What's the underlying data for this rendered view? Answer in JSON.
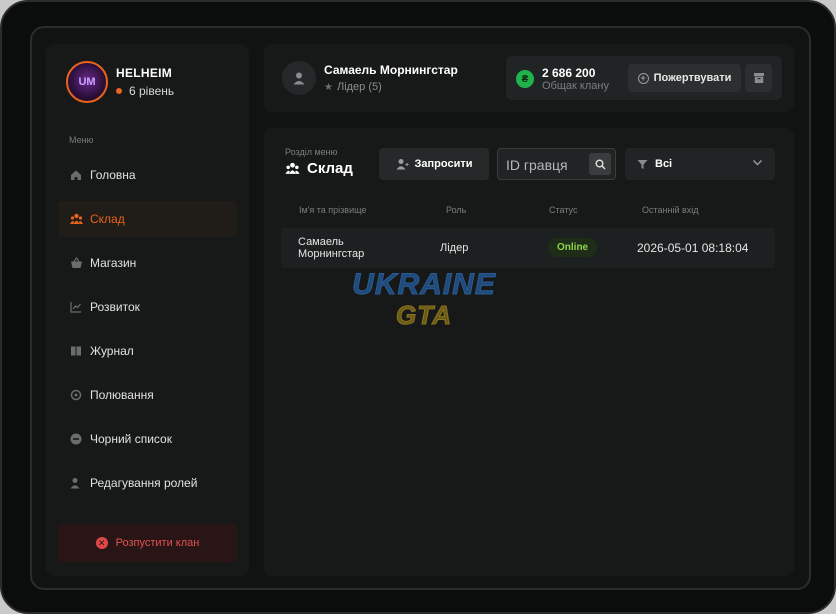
{
  "clan": {
    "name": "HELHEIM",
    "level": "6 рівень",
    "logo_text": "UM"
  },
  "sidebar": {
    "menu_caption": "Меню",
    "items": [
      {
        "label": "Головна",
        "icon": "home-icon"
      },
      {
        "label": "Склад",
        "icon": "people-icon"
      },
      {
        "label": "Магазин",
        "icon": "basket-icon"
      },
      {
        "label": "Розвиток",
        "icon": "chart-icon"
      },
      {
        "label": "Журнал",
        "icon": "book-icon"
      },
      {
        "label": "Полювання",
        "icon": "target-icon"
      },
      {
        "label": "Чорний список",
        "icon": "minus-circle-icon"
      },
      {
        "label": "Редагування ролей",
        "icon": "user-edit-icon"
      }
    ],
    "active_item": "Склад",
    "disband_label": "Розпустити клан"
  },
  "header": {
    "user_name": "Самаель Морнингстар",
    "user_role": "Лідер (5)",
    "funds_amount": "2 686 200",
    "funds_label": "Общак клану",
    "donate_label": "Пожертвувати"
  },
  "main": {
    "section_caption": "Розділ меню",
    "section_title": "Склад",
    "invite_label": "Запросити",
    "search_placeholder": "ID гравця",
    "filter_value": "Всі",
    "table": {
      "headers": [
        "Ім'я та прізвище",
        "Роль",
        "Статус",
        "Останній вхід"
      ],
      "rows": [
        {
          "name_line1": "Самаель",
          "name_line2": "Морнингстар",
          "role": "Лідер",
          "status": "Online",
          "last_login": "2026-05-01 08:18:04"
        }
      ]
    }
  },
  "watermark": {
    "line1": "UKRAINE",
    "line2": "GTA"
  },
  "colors": {
    "accent": "#e8641c",
    "online": "#8cd64a",
    "danger": "#e05252",
    "coin": "#1fb34a"
  }
}
